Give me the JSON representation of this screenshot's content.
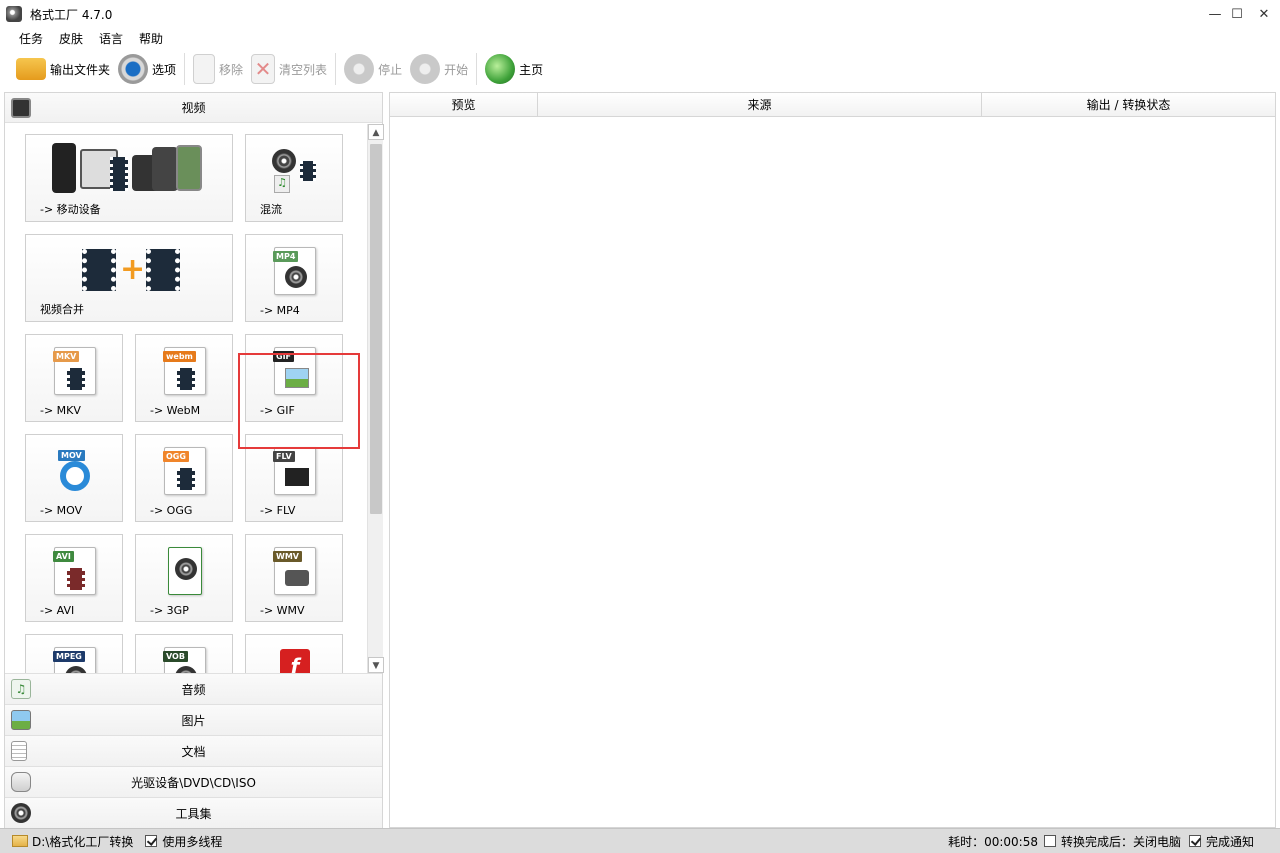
{
  "window": {
    "title": "格式工厂 4.7.0"
  },
  "menu": [
    "任务",
    "皮肤",
    "语言",
    "帮助"
  ],
  "toolbar": {
    "output_folder": "输出文件夹",
    "options": "选项",
    "remove": "移除",
    "clear_list": "清空列表",
    "stop": "停止",
    "start": "开始",
    "home": "主页"
  },
  "video_category": "视频",
  "tiles": {
    "mobile": "-> 移动设备",
    "mux": "混流",
    "merge": "视频合并",
    "mp4": "-> MP4",
    "mkv": "-> MKV",
    "webm": "-> WebM",
    "gif": "-> GIF",
    "mov": "-> MOV",
    "ogg": "-> OGG",
    "flv": "-> FLV",
    "avi": "-> AVI",
    "3gp": "-> 3GP",
    "wmv": "-> WMV"
  },
  "badges": {
    "mp4": "MP4",
    "mkv": "MKV",
    "webm": "webm",
    "gif": "GIF",
    "mov": "MOV",
    "ogg": "OGG",
    "flv": "FLV",
    "avi": "AVI",
    "wmv": "WMV",
    "mpeg": "MPEG",
    "vob": "VOB"
  },
  "categories": [
    "音频",
    "图片",
    "文档",
    "光驱设备\\DVD\\CD\\ISO",
    "工具集"
  ],
  "columns": {
    "preview": "预览",
    "source": "来源",
    "output": "输出 / 转换状态"
  },
  "status": {
    "output_path": "D:\\格式化工厂转换",
    "multithread": "使用多线程",
    "elapsed": "耗时：00:00:58",
    "shutdown": "转换完成后：关闭电脑",
    "notify": "完成通知"
  },
  "colors": {
    "highlight": "#e53a3a",
    "statusbar": "#dcdcdc"
  }
}
